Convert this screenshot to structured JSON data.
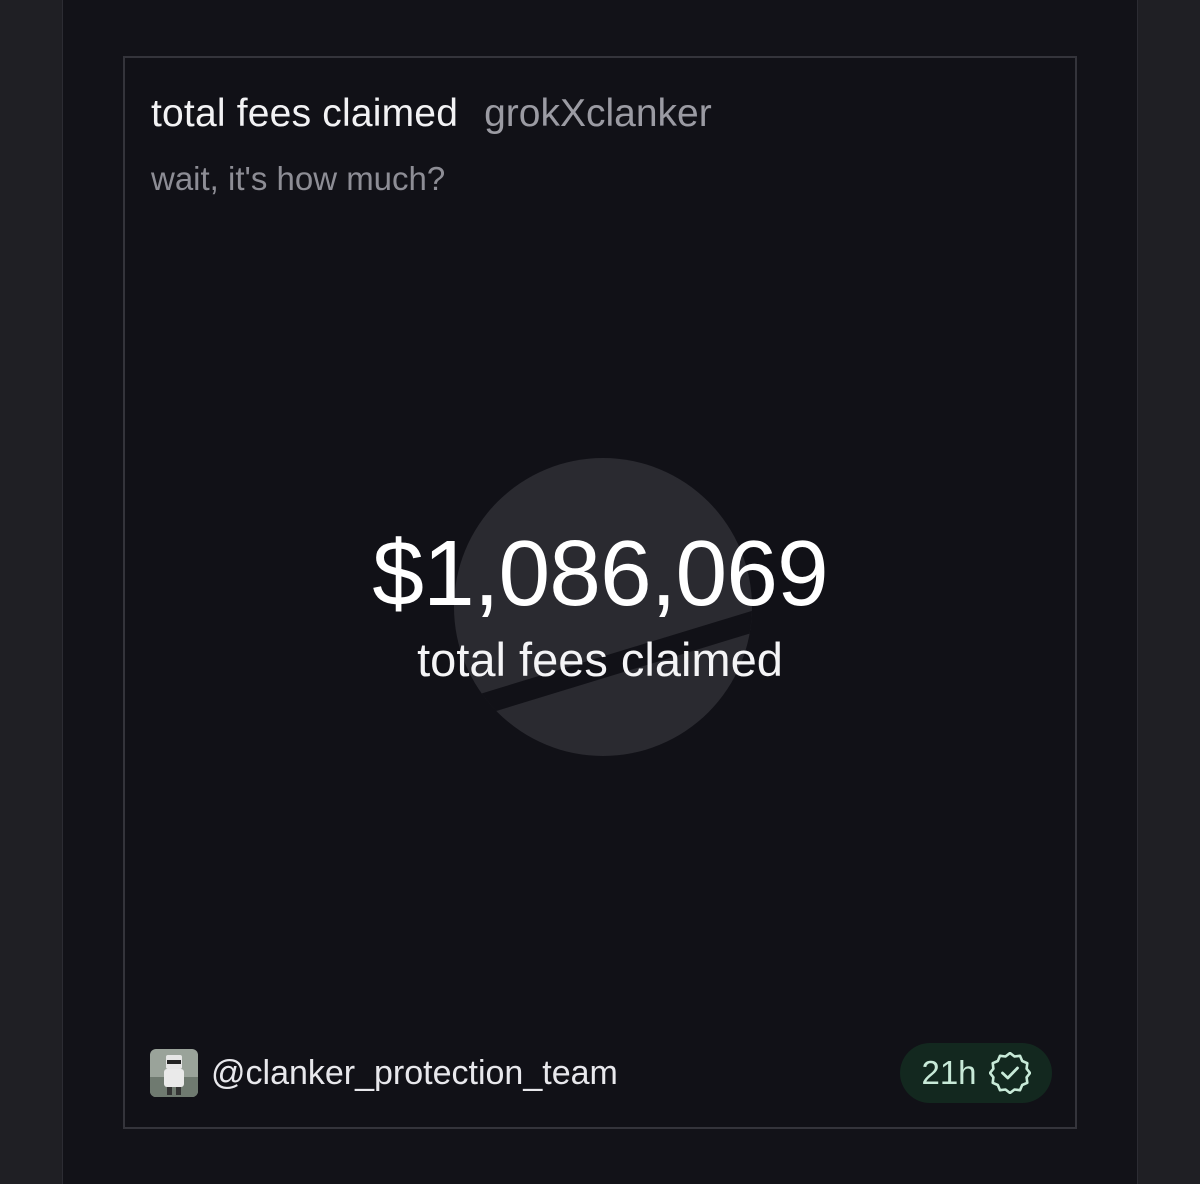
{
  "card": {
    "title": "total fees claimed",
    "tag": "grokXclanker",
    "subtitle": "wait, it's how much?"
  },
  "stat": {
    "amount": "$1,086,069",
    "caption": "total fees claimed"
  },
  "footer": {
    "author_handle": "@clanker_protection_team",
    "time_ago": "21h",
    "status_icon": "verified-badge-icon"
  },
  "colors": {
    "page_background": "#1f1f24",
    "card_background": "#111117",
    "badge_background": "#13281f",
    "badge_accent": "#c8ead8"
  }
}
